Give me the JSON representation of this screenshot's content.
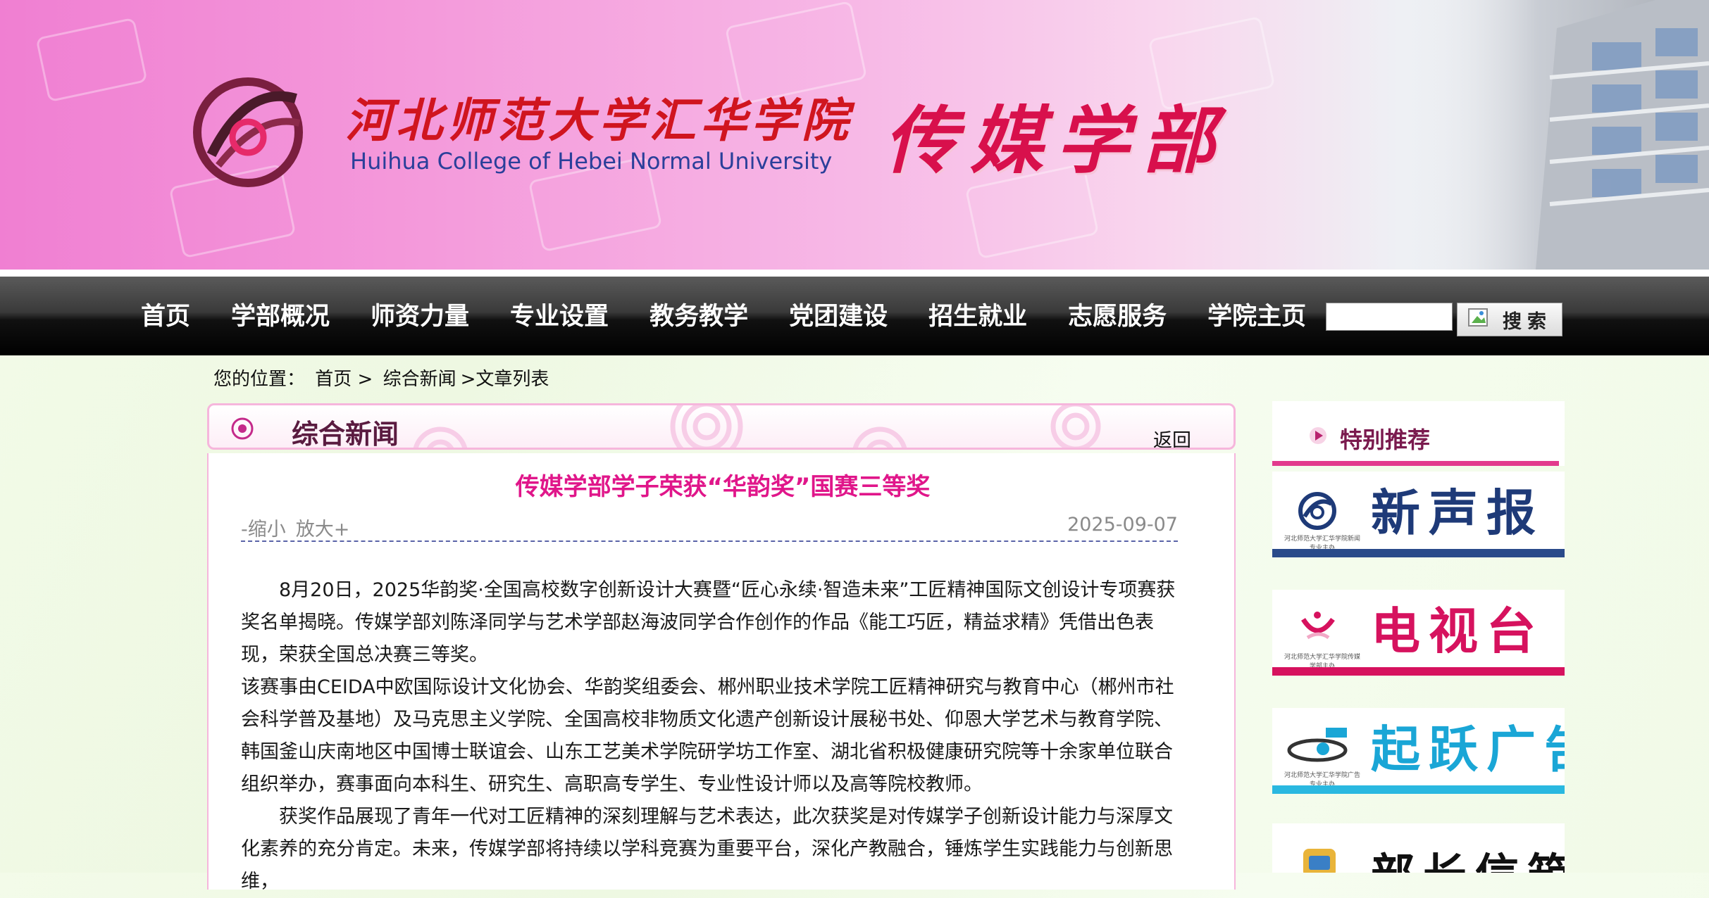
{
  "banner": {
    "cn_name": "河北师范大学汇华学院",
    "en_name": "Huihua College of Hebei Normal University",
    "dept_name": "传媒学部"
  },
  "nav": {
    "items": [
      "首页",
      "学部概况",
      "师资力量",
      "专业设置",
      "教务教学",
      "党团建设",
      "招生就业",
      "志愿服务",
      "学院主页"
    ],
    "search_value": "",
    "search_label": "搜索"
  },
  "breadcrumb": {
    "prefix": "您的位置：",
    "home": "首页 >",
    "section": "综合新闻",
    "current": ">文章列表"
  },
  "main": {
    "section_title": "综合新闻",
    "back_label": "返回",
    "article": {
      "title": "传媒学部学子荣获“华韵奖”国赛三等奖",
      "zoom_out": "-缩小",
      "zoom_in": "放大+",
      "date": "2025-09-07",
      "paragraphs": [
        "8月20日，2025华韵奖·全国高校数字创新设计大赛暨“匠心永续·智造未来”工匠精神国际文创设计专项赛获奖名单揭晓。传媒学部刘陈泽同学与艺术学部赵海波同学合作创作的作品《能工巧匠，精益求精》凭借出色表现，荣获全国总决赛三等奖。",
        "该赛事由CEIDA中欧国际设计文化协会、华韵奖组委会、郴州职业技术学院工匠精神研究与教育中心（郴州市社会科学普及基地）及马克思主义学院、全国高校非物质文化遗产创新设计展秘书处、仰恩大学艺术与教育学院、韩国釜山庆南地区中国博士联谊会、山东工艺美术学院研学坊工作室、湖北省积极健康研究院等十余家单位联合组织举办，赛事面向本科生、研究生、高职高专学生、专业性设计师以及高等院校教师。",
        "获奖作品展现了青年一代对工匠精神的深刻理解与艺术表达，此次获奖是对传媒学子创新设计能力与深厚文化素养的充分肯定。未来，传媒学部将持续以学科竞赛为重要平台，深化产教融合，锤炼学生实践能力与创新思维，"
      ]
    }
  },
  "sidebar": {
    "title": "特别推荐",
    "promos": [
      {
        "title": "新声报",
        "emblem_text": "河北师范大学汇华学院新闻专业主办",
        "color": "#1e3a78",
        "bar_color": "#2a4a8a"
      },
      {
        "title": "电视台",
        "emblem_text": "河北师范大学汇华学院传媒学部主办",
        "color": "#d6125e",
        "bar_color": "#d6125e"
      },
      {
        "title": "起跃广告",
        "emblem_text": "河北师范大学汇华学院广告专业主办",
        "color": "#1aa6d6",
        "bar_color": "#2ab8e0"
      },
      {
        "title": "部长信箱",
        "emblem_text": "",
        "color": "#111111",
        "bar_color": "#ffffff"
      }
    ]
  },
  "colors": {
    "accent_pink": "#e0168a",
    "nav_bg": "#000000",
    "panel_border": "#f6b6dc"
  }
}
